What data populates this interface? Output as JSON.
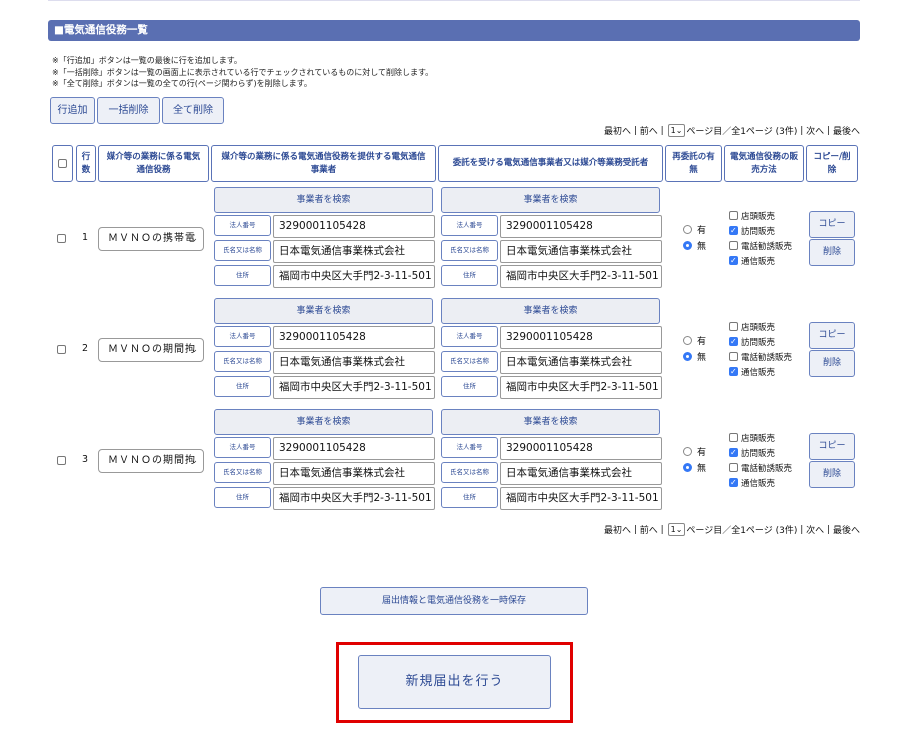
{
  "section": {
    "title": "■電気通信役務一覧"
  },
  "notes": [
    "※「行追加」ボタンは一覧の最後に行を追加します。",
    "※「一括削除」ボタンは一覧の画面上に表示されている行でチェックされているものに対して削除します。",
    "※「全て削除」ボタンは一覧の全ての行(ページ関わらず)を削除します。"
  ],
  "toolbar": {
    "add_row": "行追加",
    "bulk_delete": "一括削除",
    "delete_all": "全て削除"
  },
  "pager": {
    "first": "最初へ",
    "prev": "前へ",
    "page_value": "1",
    "suffix": "ページ目／全1ページ (3件)",
    "next": "次へ",
    "last": "最後へ",
    "sep": "|"
  },
  "headers": {
    "row_num": "行数",
    "service": "媒介等の業務に係る電気通信役務",
    "provider": "媒介等の業務に係る電気通信役務を提供する電気通信事業者",
    "consignee": "委託を受ける電気通信事業者又は媒介等業務受託者",
    "resub": "再委託の有無",
    "sales": "電気通信役務の販売方法",
    "copy_delete": "コピー/削除"
  },
  "labels": {
    "search": "事業者を検索",
    "corp_num": "法人番号",
    "name": "氏名又は名称",
    "address": "住所",
    "yes": "有",
    "no": "無",
    "copy": "コピー",
    "delete": "削除"
  },
  "sales_methods": [
    "店頭販売",
    "訪問販売",
    "電話勧誘販売",
    "通信販売"
  ],
  "rows": [
    {
      "num": "1",
      "service": "ＭＶＮＯの携帯電",
      "provider": {
        "corp": "3290001105428",
        "name": "日本電気通信事業株式会社",
        "address": "福岡市中央区大手門2-3-11-501"
      },
      "consignee": {
        "corp": "3290001105428",
        "name": "日本電気通信事業株式会社",
        "address": "福岡市中央区大手門2-3-11-501"
      },
      "resub": "無",
      "sales": [
        false,
        true,
        false,
        true
      ]
    },
    {
      "num": "2",
      "service": "ＭＶＮＯの期間拘",
      "provider": {
        "corp": "3290001105428",
        "name": "日本電気通信事業株式会社",
        "address": "福岡市中央区大手門2-3-11-501"
      },
      "consignee": {
        "corp": "3290001105428",
        "name": "日本電気通信事業株式会社",
        "address": "福岡市中央区大手門2-3-11-501"
      },
      "resub": "無",
      "sales": [
        false,
        true,
        false,
        true
      ]
    },
    {
      "num": "3",
      "service": "ＭＶＮＯの期間拘",
      "provider": {
        "corp": "3290001105428",
        "name": "日本電気通信事業株式会社",
        "address": "福岡市中央区大手門2-3-11-501"
      },
      "consignee": {
        "corp": "3290001105428",
        "name": "日本電気通信事業株式会社",
        "address": "福岡市中央区大手門2-3-11-501"
      },
      "resub": "無",
      "sales": [
        false,
        true,
        false,
        true
      ]
    }
  ],
  "actions": {
    "save_temp": "届出情報と電気通信役務を一時保存",
    "new_submission": "新規届出を行う"
  },
  "colors": {
    "accent": "#5a6fb2",
    "highlight": "#e00000",
    "checkbox": "#3478f6"
  }
}
